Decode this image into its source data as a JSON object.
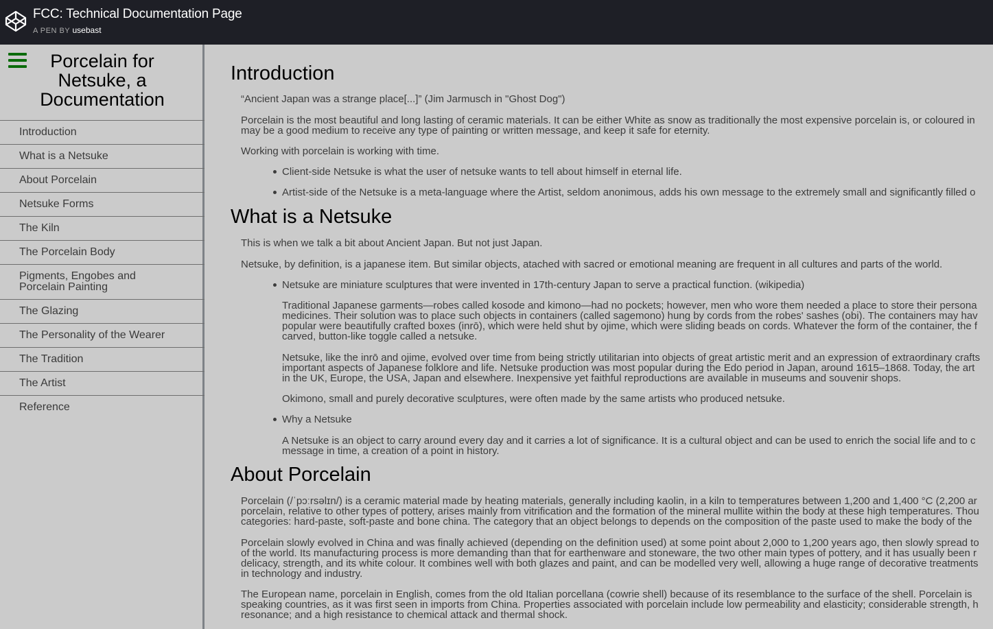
{
  "topbar": {
    "title": "FCC: Technical Documentation Page",
    "pen_by": "A PEN BY",
    "author": "usebast"
  },
  "sidebar": {
    "title_lines": [
      "Porcelain for",
      "Netsuke, a",
      "Documentation"
    ],
    "items": [
      {
        "label": "Introduction"
      },
      {
        "label": "What is a Netsuke"
      },
      {
        "label": "About Porcelain"
      },
      {
        "label": "Netsuke Forms"
      },
      {
        "label": "The Kiln"
      },
      {
        "label": "The Porcelain Body"
      },
      {
        "label": "Pigments, Engobes and",
        "label2": "Porcelain Painting"
      },
      {
        "label": "The Glazing"
      },
      {
        "label": "The Personality of the Wearer"
      },
      {
        "label": "The Tradition"
      },
      {
        "label": "The Artist"
      },
      {
        "label": "Reference"
      }
    ]
  },
  "main": {
    "intro": {
      "heading": "Introduction",
      "quote": "“Ancient Japan was a strange place[...]” (Jim Jarmusch in \"Ghost Dog\")",
      "p1_l1": "Porcelain is the most beautiful and long lasting of ceramic materials. It can be either White as snow as traditionally the most expensive porcelain is, or coloured in",
      "p1_l2": "may be a good medium to receive any type of painting or written message, and keep it safe for eternity.",
      "p2": "Working with porcelain is working with time.",
      "b1": "Client-side Netsuke is what the user of netsuke wants to tell about himself in eternal life.",
      "b2": "Artist-side of the Netsuke is a meta-language where the Artist, seldom anonimous, adds his own message to the extremely small and significantly filled o"
    },
    "netsuke": {
      "heading": "What is a Netsuke",
      "p1": "This is when we talk a bit about Ancient Japan. But not just Japan.",
      "p2": "Netsuke, by definition, is a japanese item. But similar objects, atached with sacred or emotional meaning are frequent in all cultures and parts of the world.",
      "b1": "Netsuke are miniature sculptures that were invented in 17th-century Japan to serve a practical function. (wikipedia)",
      "b1p1_l1": "Traditional Japanese garments—robes called kosode and kimono—had no pockets; however, men who wore them needed a place to store their persona",
      "b1p1_l2": "medicines. Their solution was to place such objects in containers (called sagemono) hung by cords from the robes' sashes (obi). The containers may hav",
      "b1p1_l3": "popular were beautifully crafted boxes (inrō), which were held shut by ojime, which were sliding beads on cords. Whatever the form of the container, the f",
      "b1p1_l4": "carved, button-like toggle called a netsuke.",
      "b1p2_l1": "Netsuke, like the inrō and ojime, evolved over time from being strictly utilitarian into objects of great artistic merit and an expression of extraordinary crafts",
      "b1p2_l2": "important aspects of Japanese folklore and life. Netsuke production was most popular during the Edo period in Japan, around 1615–1868. Today, the art",
      "b1p2_l3": "in the UK, Europe, the USA, Japan and elsewhere. Inexpensive yet faithful reproductions are available in museums and souvenir shops.",
      "b1p3": "Okimono, small and purely decorative sculptures, were often made by the same artists who produced netsuke.",
      "b2": "Why a Netsuke",
      "b2p1_l1": "A Netsuke is an object to carry around every day and it carries a lot of significance. It is a cultural object and can be used to enrich the social life and to c",
      "b2p1_l2": "message in time, a creation of a point in history."
    },
    "porcelain": {
      "heading": "About Porcelain",
      "p1_l1": "Porcelain (/ˈpɔːrsəlɪn/) is a ceramic material made by heating materials, generally including kaolin, in a kiln to temperatures between 1,200 and 1,400 °C (2,200 ar",
      "p1_l2": "porcelain, relative to other types of pottery, arises mainly from vitrification and the formation of the mineral mullite within the body at these high temperatures. Thou",
      "p1_l3": "categories: hard-paste, soft-paste and bone china. The category that an object belongs to depends on the composition of the paste used to make the body of the",
      "p2_l1": "Porcelain slowly evolved in China and was finally achieved (depending on the definition used) at some point about 2,000 to 1,200 years ago, then slowly spread to",
      "p2_l2": "of the world. Its manufacturing process is more demanding than that for earthenware and stoneware, the two other main types of pottery, and it has usually been r",
      "p2_l3": "delicacy, strength, and its white colour. It combines well with both glazes and paint, and can be modelled very well, allowing a huge range of decorative treatments",
      "p2_l4": "in technology and industry.",
      "p3_l1": "The European name, porcelain in English, comes from the old Italian porcellana (cowrie shell) because of its resemblance to the surface of the shell. Porcelain is",
      "p3_l2": "speaking countries, as it was first seen in imports from China. Properties associated with porcelain include low permeability and elasticity; considerable strength, h",
      "p3_l3": "resonance; and a high resistance to chemical attack and thermal shock."
    }
  },
  "colors": {
    "topbar_bg": "#1e1f26",
    "page_bg": "#cbcbcb",
    "menu_icon": "#0a6b0a",
    "sidebar_border": "#7e8287"
  },
  "icons": {
    "logo": "codepen-logo-icon",
    "menu": "hamburger-menu-icon"
  }
}
